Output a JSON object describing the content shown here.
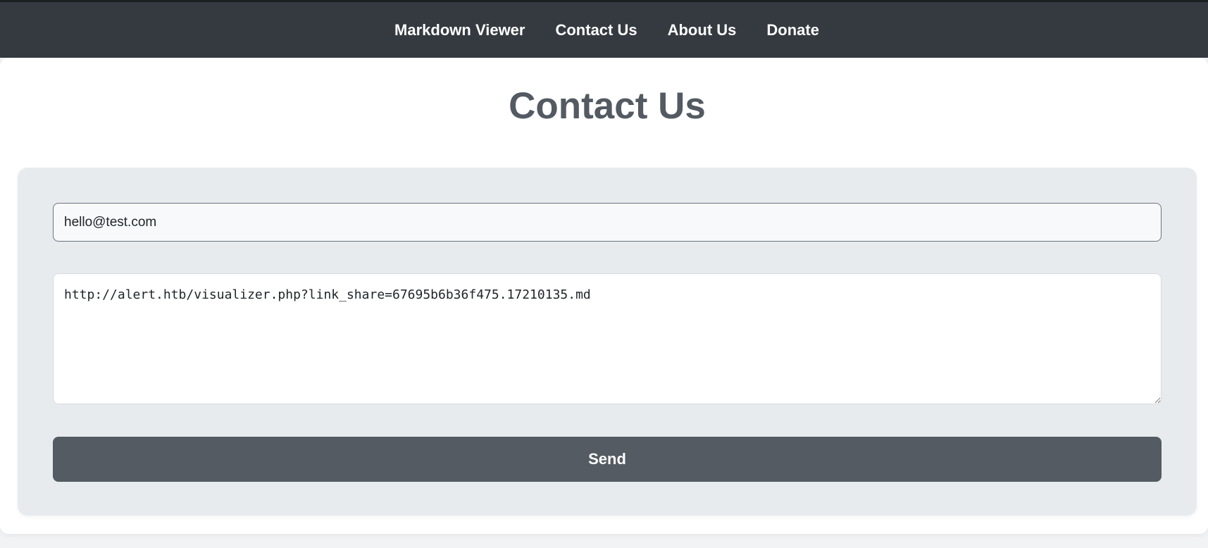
{
  "nav": {
    "items": [
      {
        "label": "Markdown Viewer"
      },
      {
        "label": "Contact Us"
      },
      {
        "label": "About Us"
      },
      {
        "label": "Donate"
      }
    ]
  },
  "page": {
    "title": "Contact Us"
  },
  "form": {
    "email": {
      "value": "hello@test.com",
      "placeholder": ""
    },
    "message": {
      "value": "http://alert.htb/visualizer.php?link_share=67695b6b36f475.17210135.md",
      "placeholder": ""
    },
    "send_label": "Send"
  },
  "colors": {
    "navbar": "#343a40",
    "title": "#535a62",
    "panel": "#e8ebee",
    "button": "#545b62"
  }
}
